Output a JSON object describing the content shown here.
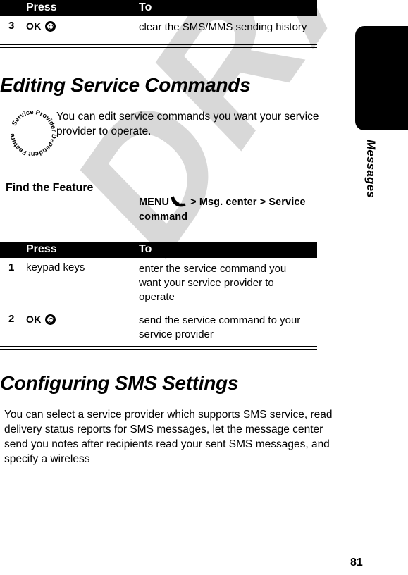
{
  "watermark": {
    "text": "DRAFT"
  },
  "chapter": {
    "label": "Messages",
    "tab_color": "#000000"
  },
  "page_number": "81",
  "table_top": {
    "headers": {
      "press": "Press",
      "to": "To"
    },
    "rows": [
      {
        "num": "3",
        "press_label": "OK",
        "press_icon": "ok-ring-icon",
        "to": "clear the SMS/MMS sending history"
      }
    ]
  },
  "section_editing": {
    "heading": "Editing Service Commands",
    "badge_text": "Service Provider Dependent Feature",
    "paragraph": "You can edit service commands you want your service provider to operate.",
    "find_feature": {
      "label": "Find the Feature",
      "menu_label": "MENU",
      "menu_icon": "menu-key-icon",
      "separator_1": ">",
      "item_1": "Msg. center",
      "separator_2": ">",
      "item_2": "Service command"
    },
    "table": {
      "headers": {
        "press": "Press",
        "to": "To"
      },
      "rows": [
        {
          "num": "1",
          "press_label": "keypad keys",
          "press_icon": "",
          "to": "enter the service command you want your service provider to operate"
        },
        {
          "num": "2",
          "press_label": "OK",
          "press_icon": "ok-ring-icon",
          "to": "send the service command to your service provider"
        }
      ]
    }
  },
  "section_configuring": {
    "heading": "Configuring SMS Settings",
    "paragraph": "You can select a service provider which supports SMS service, read delivery status reports for SMS messages, let the message center send you notes after recipients read your sent SMS messages, and specify a wireless"
  }
}
